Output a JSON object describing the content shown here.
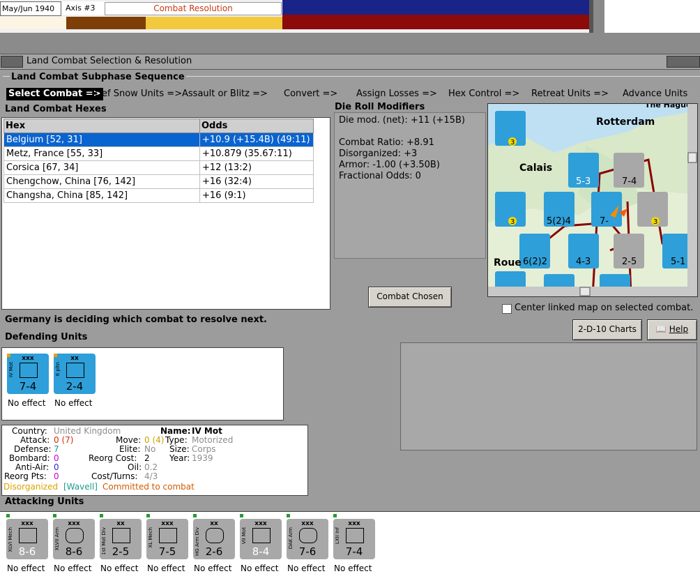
{
  "header": {
    "date": "May/Jun 1940",
    "axis": "Axis #3",
    "phase": "Combat Resolution"
  },
  "window": {
    "title": "Land Combat Selection & Resolution"
  },
  "sequence": {
    "title": "Land Combat Subphase Sequence",
    "steps": [
      "Select Combat =>",
      "Def Snow Units =>",
      "Assault or Blitz =>",
      "Convert =>",
      "Assign Losses =>",
      "Hex Control =>",
      "Retreat Units =>",
      "Advance Units"
    ]
  },
  "hexes": {
    "title": "Land Combat Hexes",
    "columns": [
      "Hex",
      "Odds"
    ],
    "rows": [
      {
        "hex": "Belgium [52, 31]",
        "odds": "+10.9 (+15.4B) (49:11)"
      },
      {
        "hex": "Metz, France [55, 33]",
        "odds": "+10.879 (35.67:11)"
      },
      {
        "hex": "Corsica [67, 34]",
        "odds": "+12 (13:2)"
      },
      {
        "hex": "Chengchow, China [76, 142]",
        "odds": "+16 (32:4)"
      },
      {
        "hex": "Changsha, China [85, 142]",
        "odds": "+16 (9:1)"
      }
    ]
  },
  "drm": {
    "title": "Die Roll Modifiers",
    "lines": [
      "Die mod. (net): +11 (+15B)",
      "",
      "Combat Ratio: +8.91",
      "Disorganized: +3",
      "Armor: -1.00 (+3.50B)",
      "Fractional Odds: 0"
    ]
  },
  "map": {
    "labels": [
      "Rotterdam",
      "Calais",
      "Roue",
      "The Hague"
    ],
    "counter_labels": [
      "5-3",
      "7-4",
      "5(2)4",
      "7-",
      "6(2)2",
      "4-3",
      "2-5",
      "5-1",
      "3",
      "3",
      "3"
    ]
  },
  "buttons": {
    "combat_chosen": "Combat Chosen",
    "charts": "2-D-10 Charts",
    "help": "Help"
  },
  "center_map_label": "Center linked map on selected combat.",
  "status": "Germany is deciding which combat to resolve next.",
  "defenders": {
    "title": "Defending Units",
    "units": [
      {
        "size": "xxx",
        "name": "IV Mot",
        "strength": "7-4",
        "result": "No effect"
      },
      {
        "size": "xx",
        "name": "6 pltn",
        "strength": "2-4",
        "result": "No effect"
      }
    ]
  },
  "unit_info": {
    "country_label": "Country:",
    "country": "United Kingdom",
    "name_label": "Name:",
    "name": "IV Mot",
    "attack_label": "Attack:",
    "attack": "0 (7)",
    "move_label": "Move:",
    "move": "0 (4)",
    "type_label": "Type:",
    "type": "Motorized",
    "defense_label": "Defense:",
    "defense": "7",
    "elite_label": "Elite:",
    "elite": "No",
    "size_label": "Size:",
    "size": "Corps",
    "bombard_label": "Bombard:",
    "bombard": "0",
    "reorg_cost_label": "Reorg Cost:",
    "reorg_cost": "2",
    "year_label": "Year:",
    "year": "1939",
    "antiair_label": "Anti-Air:",
    "antiair": "0",
    "oil_label": "Oil:",
    "oil": "0.2",
    "reorg_pts_label": "Reorg Pts:",
    "reorg_pts": "0",
    "cost_turns_label": "Cost/Turns:",
    "cost_turns": "4/3",
    "status_disorg": "Disorganized",
    "status_leader": "[Wavell]",
    "status_committed": "Committed to combat"
  },
  "attackers": {
    "title": "Attacking Units",
    "units": [
      {
        "size": "xxx",
        "name": "XLVI Mech",
        "strength": "8-6",
        "result": "No effect",
        "r": "R"
      },
      {
        "size": "xxx",
        "name": "XLVII Arm",
        "strength": "8-6",
        "result": "No effect",
        "r": ""
      },
      {
        "size": "xx",
        "name": "1st Mot Div",
        "strength": "2-5",
        "result": "No effect",
        "r": ""
      },
      {
        "size": "xxx",
        "name": "XL Mech",
        "strength": "7-5",
        "result": "No effect",
        "r": ""
      },
      {
        "size": "xx",
        "name": "HG Arm Div",
        "strength": "2-6",
        "result": "No effect",
        "r": ""
      },
      {
        "size": "xxx",
        "name": "VII Mot",
        "strength": "8-4",
        "result": "No effect",
        "r": "R"
      },
      {
        "size": "xxx",
        "name": "DAK Arm",
        "strength": "7-6",
        "result": "No effect",
        "r": ""
      },
      {
        "size": "xxx",
        "name": "LXII Inf",
        "strength": "7-4",
        "result": "No effect",
        "r": ""
      }
    ]
  },
  "colors": {
    "selection": "#0a64d0",
    "german_counter": "#a8a8a8",
    "allied_counter": "#2e9fd8",
    "red_text": "#d42a00",
    "orange_text": "#d9a400",
    "teal_text": "#1c9c8c",
    "magenta_text": "#d000d0"
  }
}
